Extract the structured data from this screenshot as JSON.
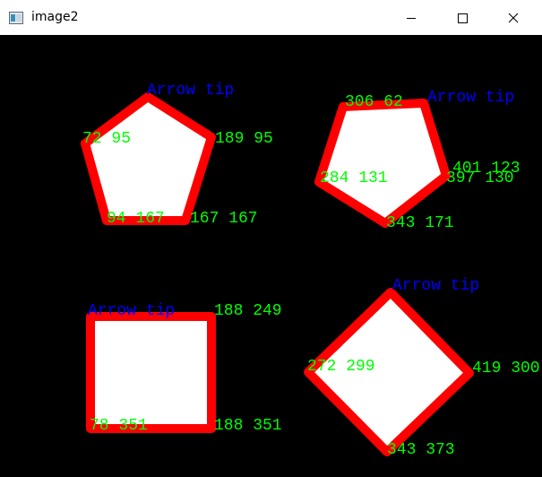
{
  "window": {
    "title": "image2",
    "icons": {
      "app": "image-window-icon",
      "minimize": "minimize-icon",
      "maximize": "maximize-icon",
      "close": "close-icon"
    }
  },
  "colors": {
    "canvas_bg": "#000000",
    "shape_fill": "#ffffff",
    "shape_outline": "#ff0000",
    "coord_text": "#00ff00",
    "tip_text": "#0000ff"
  },
  "labels": {
    "pentagon1": {
      "tip": "Arrow tip",
      "c1": "72 95",
      "c2": "189 95",
      "c3": "94 167",
      "c4": "167 167"
    },
    "pentagon2": {
      "tip": "Arrow tip",
      "c1": "306 62",
      "c2": "284 131",
      "c3": "401 123",
      "c4": "397 130",
      "c5": "343 171"
    },
    "square": {
      "tip": "Arrow tip",
      "c1": "188 249",
      "c2": "78 351",
      "c3": "188 351"
    },
    "diamond": {
      "tip": "Arrow tip",
      "c1": "272 299",
      "c2": "419 300",
      "c3": "343 373"
    }
  }
}
